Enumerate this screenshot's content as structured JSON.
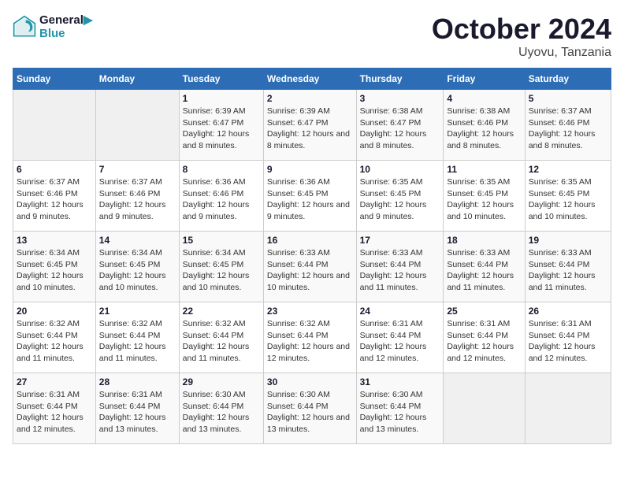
{
  "header": {
    "logo_line1": "General",
    "logo_line2": "Blue",
    "month": "October 2024",
    "location": "Uyovu, Tanzania"
  },
  "weekdays": [
    "Sunday",
    "Monday",
    "Tuesday",
    "Wednesday",
    "Thursday",
    "Friday",
    "Saturday"
  ],
  "weeks": [
    [
      {
        "day": "",
        "info": ""
      },
      {
        "day": "",
        "info": ""
      },
      {
        "day": "1",
        "info": "Sunrise: 6:39 AM\nSunset: 6:47 PM\nDaylight: 12 hours and 8 minutes."
      },
      {
        "day": "2",
        "info": "Sunrise: 6:39 AM\nSunset: 6:47 PM\nDaylight: 12 hours and 8 minutes."
      },
      {
        "day": "3",
        "info": "Sunrise: 6:38 AM\nSunset: 6:47 PM\nDaylight: 12 hours and 8 minutes."
      },
      {
        "day": "4",
        "info": "Sunrise: 6:38 AM\nSunset: 6:46 PM\nDaylight: 12 hours and 8 minutes."
      },
      {
        "day": "5",
        "info": "Sunrise: 6:37 AM\nSunset: 6:46 PM\nDaylight: 12 hours and 8 minutes."
      }
    ],
    [
      {
        "day": "6",
        "info": "Sunrise: 6:37 AM\nSunset: 6:46 PM\nDaylight: 12 hours and 9 minutes."
      },
      {
        "day": "7",
        "info": "Sunrise: 6:37 AM\nSunset: 6:46 PM\nDaylight: 12 hours and 9 minutes."
      },
      {
        "day": "8",
        "info": "Sunrise: 6:36 AM\nSunset: 6:46 PM\nDaylight: 12 hours and 9 minutes."
      },
      {
        "day": "9",
        "info": "Sunrise: 6:36 AM\nSunset: 6:45 PM\nDaylight: 12 hours and 9 minutes."
      },
      {
        "day": "10",
        "info": "Sunrise: 6:35 AM\nSunset: 6:45 PM\nDaylight: 12 hours and 9 minutes."
      },
      {
        "day": "11",
        "info": "Sunrise: 6:35 AM\nSunset: 6:45 PM\nDaylight: 12 hours and 10 minutes."
      },
      {
        "day": "12",
        "info": "Sunrise: 6:35 AM\nSunset: 6:45 PM\nDaylight: 12 hours and 10 minutes."
      }
    ],
    [
      {
        "day": "13",
        "info": "Sunrise: 6:34 AM\nSunset: 6:45 PM\nDaylight: 12 hours and 10 minutes."
      },
      {
        "day": "14",
        "info": "Sunrise: 6:34 AM\nSunset: 6:45 PM\nDaylight: 12 hours and 10 minutes."
      },
      {
        "day": "15",
        "info": "Sunrise: 6:34 AM\nSunset: 6:45 PM\nDaylight: 12 hours and 10 minutes."
      },
      {
        "day": "16",
        "info": "Sunrise: 6:33 AM\nSunset: 6:44 PM\nDaylight: 12 hours and 10 minutes."
      },
      {
        "day": "17",
        "info": "Sunrise: 6:33 AM\nSunset: 6:44 PM\nDaylight: 12 hours and 11 minutes."
      },
      {
        "day": "18",
        "info": "Sunrise: 6:33 AM\nSunset: 6:44 PM\nDaylight: 12 hours and 11 minutes."
      },
      {
        "day": "19",
        "info": "Sunrise: 6:33 AM\nSunset: 6:44 PM\nDaylight: 12 hours and 11 minutes."
      }
    ],
    [
      {
        "day": "20",
        "info": "Sunrise: 6:32 AM\nSunset: 6:44 PM\nDaylight: 12 hours and 11 minutes."
      },
      {
        "day": "21",
        "info": "Sunrise: 6:32 AM\nSunset: 6:44 PM\nDaylight: 12 hours and 11 minutes."
      },
      {
        "day": "22",
        "info": "Sunrise: 6:32 AM\nSunset: 6:44 PM\nDaylight: 12 hours and 11 minutes."
      },
      {
        "day": "23",
        "info": "Sunrise: 6:32 AM\nSunset: 6:44 PM\nDaylight: 12 hours and 12 minutes."
      },
      {
        "day": "24",
        "info": "Sunrise: 6:31 AM\nSunset: 6:44 PM\nDaylight: 12 hours and 12 minutes."
      },
      {
        "day": "25",
        "info": "Sunrise: 6:31 AM\nSunset: 6:44 PM\nDaylight: 12 hours and 12 minutes."
      },
      {
        "day": "26",
        "info": "Sunrise: 6:31 AM\nSunset: 6:44 PM\nDaylight: 12 hours and 12 minutes."
      }
    ],
    [
      {
        "day": "27",
        "info": "Sunrise: 6:31 AM\nSunset: 6:44 PM\nDaylight: 12 hours and 12 minutes."
      },
      {
        "day": "28",
        "info": "Sunrise: 6:31 AM\nSunset: 6:44 PM\nDaylight: 12 hours and 13 minutes."
      },
      {
        "day": "29",
        "info": "Sunrise: 6:30 AM\nSunset: 6:44 PM\nDaylight: 12 hours and 13 minutes."
      },
      {
        "day": "30",
        "info": "Sunrise: 6:30 AM\nSunset: 6:44 PM\nDaylight: 12 hours and 13 minutes."
      },
      {
        "day": "31",
        "info": "Sunrise: 6:30 AM\nSunset: 6:44 PM\nDaylight: 12 hours and 13 minutes."
      },
      {
        "day": "",
        "info": ""
      },
      {
        "day": "",
        "info": ""
      }
    ]
  ]
}
